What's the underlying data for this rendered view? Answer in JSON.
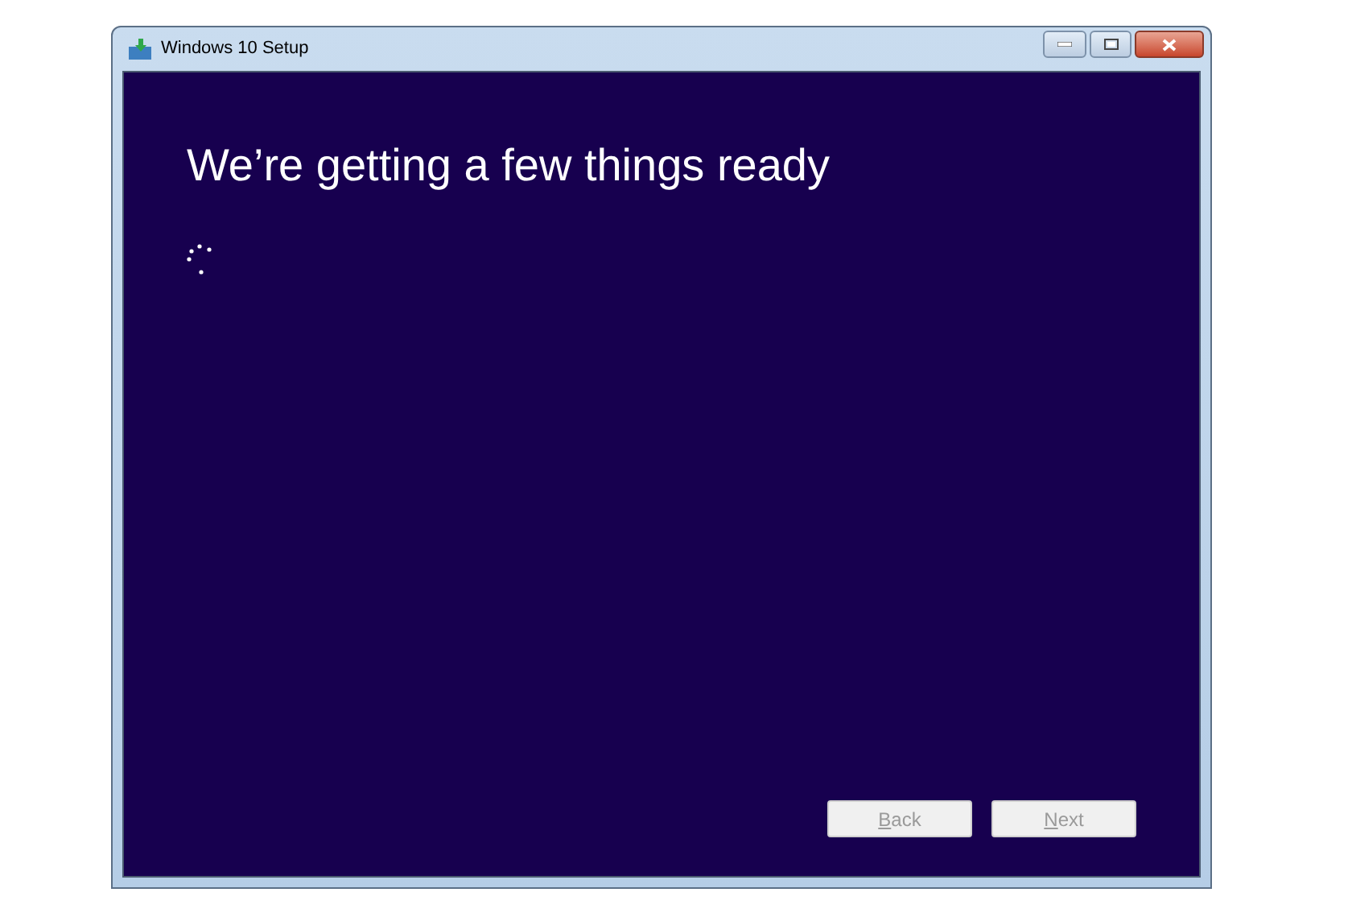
{
  "window": {
    "title": "Windows 10 Setup"
  },
  "heading": "We’re getting a few things ready",
  "buttons": [
    {
      "label": "Back",
      "access_key_underlined": true,
      "disabled": true
    },
    {
      "label": "Next",
      "access_key_underlined": true,
      "disabled": true
    }
  ]
}
